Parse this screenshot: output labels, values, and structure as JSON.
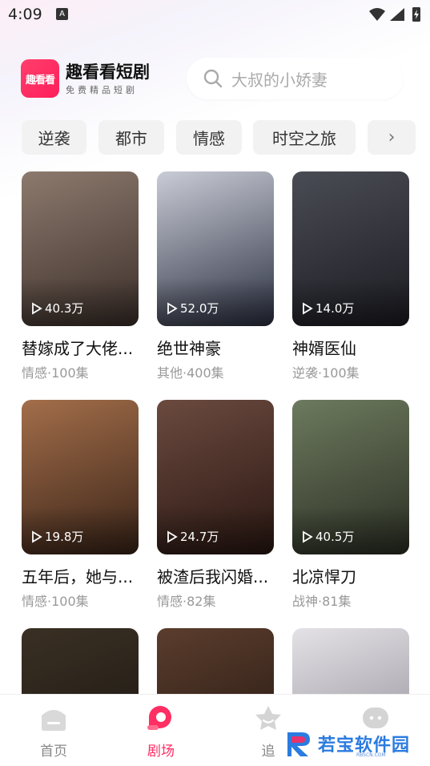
{
  "status_bar": {
    "time": "4:09",
    "notification_badge": "A"
  },
  "header": {
    "logo_text": "趣看看",
    "app_title": "趣看看短剧",
    "app_subtitle": "免费精品短剧",
    "search_placeholder": "大叔的小娇妻"
  },
  "categories": [
    "逆袭",
    "都市",
    "情感",
    "时空之旅"
  ],
  "dramas": [
    {
      "title": "替嫁成了大佬...",
      "meta": "情感·100集",
      "views": "40.3万",
      "color1": "#8d7a6e",
      "color2": "#3c2f2a"
    },
    {
      "title": "绝世神豪",
      "meta": "其他·400集",
      "views": "52.0万",
      "color1": "#c9ccd6",
      "color2": "#2c3142"
    },
    {
      "title": "神婿医仙",
      "meta": "逆袭·100集",
      "views": "14.0万",
      "color1": "#4a4c55",
      "color2": "#1c1c22"
    },
    {
      "title": "五年后，她与...",
      "meta": "情感·100集",
      "views": "19.8万",
      "color1": "#a36e4a",
      "color2": "#3a2418"
    },
    {
      "title": "被渣后我闪婚...",
      "meta": "情感·82集",
      "views": "24.7万",
      "color1": "#6b4a3f",
      "color2": "#2a1712"
    },
    {
      "title": "北凉悍刀",
      "meta": "战神·81集",
      "views": "40.5万",
      "color1": "#6d7a5e",
      "color2": "#2b2f24"
    },
    {
      "title": "",
      "meta": "",
      "views": "",
      "color1": "#3a3024",
      "color2": "#1a1510"
    },
    {
      "title": "",
      "meta": "",
      "views": "",
      "color1": "#5b3d2d",
      "color2": "#20140f"
    },
    {
      "title": "",
      "meta": "",
      "views": "",
      "color1": "#e4e2e6",
      "color2": "#8a8590"
    }
  ],
  "tabs": [
    {
      "label": "首页",
      "icon": "home-icon",
      "active": false
    },
    {
      "label": "剧场",
      "icon": "theater-icon",
      "active": true
    },
    {
      "label": "追",
      "icon": "star-icon",
      "active": false
    },
    {
      "label": "",
      "icon": "profile-icon",
      "active": false
    }
  ],
  "watermark": {
    "text": "若宝软件园",
    "sub": "RBSCN.COM"
  },
  "colors": {
    "accent": "#ff2e63",
    "chip_bg": "#f2f2f2"
  }
}
